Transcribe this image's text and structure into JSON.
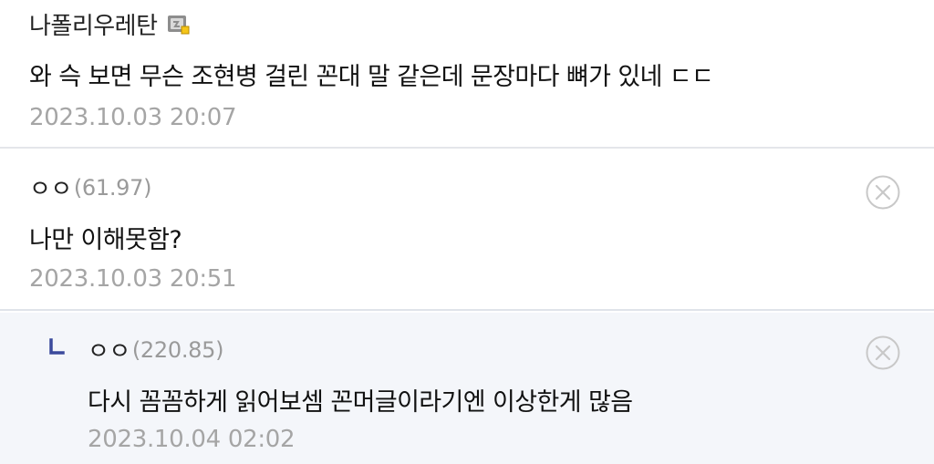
{
  "comments": [
    {
      "nickname": "나폴리우레탄",
      "ip": "",
      "text": "와 슥 보면 무슨 조현병 걸린 꼰대 말 같은데 문장마다 뼈가 있네 ㄷㄷ",
      "date": "2023.10.03 20:07",
      "icon": "fixed-nick-icon"
    },
    {
      "nickname": "ㅇㅇ",
      "ip": "(61.97)",
      "text": "나만 이해못함?",
      "date": "2023.10.03 20:51",
      "icon": "delete-circle-icon"
    },
    {
      "nickname": "ㅇㅇ",
      "ip": "(220.85)",
      "text": "다시 꼼꼼하게 읽어보셈 꼰머글이라기엔 이상한게 많음",
      "date": "2023.10.04 02:02",
      "icon": "delete-circle-icon",
      "is_reply": true
    }
  ],
  "colors": {
    "text": "#111111",
    "meta": "#a5a5a5",
    "reply_bg": "#f4f6fa",
    "reply_mark": "#3b4a9c"
  }
}
